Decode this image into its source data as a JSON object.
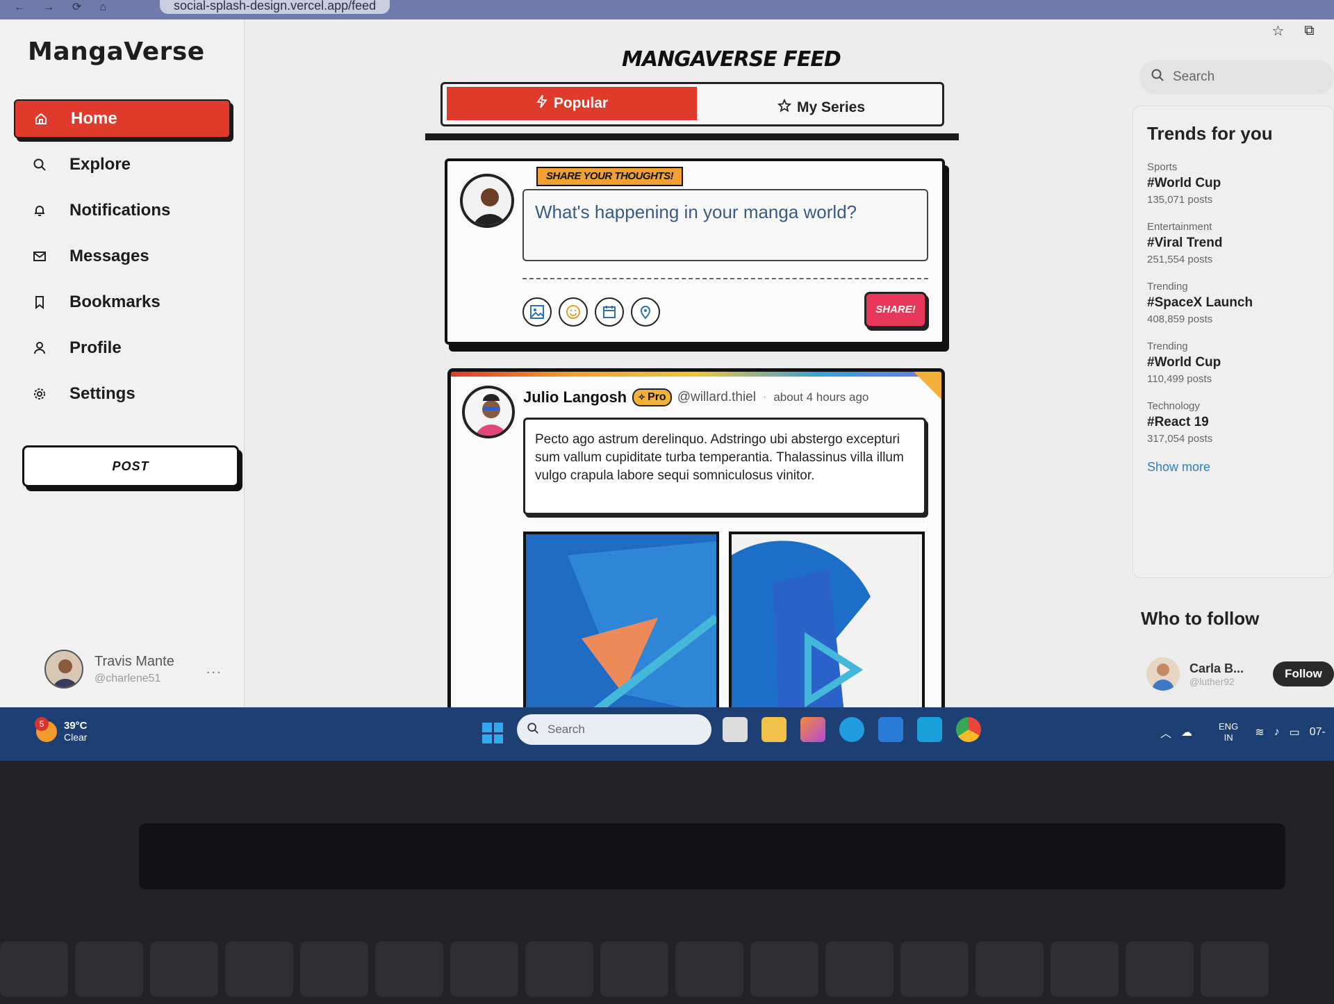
{
  "browser": {
    "url": "social-splash-design.vercel.app/feed"
  },
  "sidebar": {
    "brand": "MangaVerse",
    "items": [
      {
        "label": "Home",
        "icon": "home-icon",
        "active": true
      },
      {
        "label": "Explore",
        "icon": "search-icon"
      },
      {
        "label": "Notifications",
        "icon": "bell-icon"
      },
      {
        "label": "Messages",
        "icon": "mail-icon"
      },
      {
        "label": "Bookmarks",
        "icon": "bookmark-icon"
      },
      {
        "label": "Profile",
        "icon": "user-icon"
      },
      {
        "label": "Settings",
        "icon": "gear-icon"
      }
    ],
    "post_button": "POST",
    "user": {
      "name": "Travis Mante",
      "handle": "@charlene51",
      "more": "..."
    }
  },
  "feed": {
    "title": "MANGAVERSE FEED",
    "tabs": [
      {
        "label": "Popular",
        "active": true,
        "icon": "lightning-icon"
      },
      {
        "label": "My Series",
        "active": false,
        "icon": "star-icon"
      }
    ],
    "compose": {
      "tag": "SHARE YOUR THOUGHTS!",
      "placeholder": "What's happening in your manga world?",
      "share_button": "SHARE!",
      "tools": [
        "image-icon",
        "emoji-icon",
        "calendar-icon",
        "location-icon"
      ]
    },
    "post": {
      "author": "Julio Langosh",
      "badge": "Pro",
      "handle": "@willard.thiel",
      "separator": "·",
      "time": "about 4 hours ago",
      "body": "Pecto ago astrum derelinquo. Adstringo ubi abstergo excepturi sum vallum cupiditate turba temperantia. Thalassinus villa illum vulgo crapula labore sequi somniculosus vinitor."
    }
  },
  "right": {
    "search_placeholder": "Search",
    "trends_title": "Trends for you",
    "trends": [
      {
        "category": "Sports",
        "tag": "#World Cup",
        "count": "135,071 posts"
      },
      {
        "category": "Entertainment",
        "tag": "#Viral Trend",
        "count": "251,554 posts"
      },
      {
        "category": "Trending",
        "tag": "#SpaceX Launch",
        "count": "408,859 posts"
      },
      {
        "category": "Trending",
        "tag": "#World Cup",
        "count": "110,499 posts"
      },
      {
        "category": "Technology",
        "tag": "#React 19",
        "count": "317,054 posts"
      }
    ],
    "show_more": "Show more",
    "who_to_follow": "Who to follow",
    "suggest": {
      "name": "Carla B...",
      "handle": "@luther92",
      "button": "Follow"
    }
  },
  "taskbar": {
    "weather_temp": "39°C",
    "weather_cond": "Clear",
    "weather_badge": "5",
    "search": "Search",
    "lang_top": "ENG",
    "lang_bottom": "IN",
    "time": "07-"
  },
  "colors": {
    "accent": "#e03a2c",
    "share": "#e8375a",
    "badge": "#f2b23a",
    "taskbar": "#1d3f73"
  }
}
